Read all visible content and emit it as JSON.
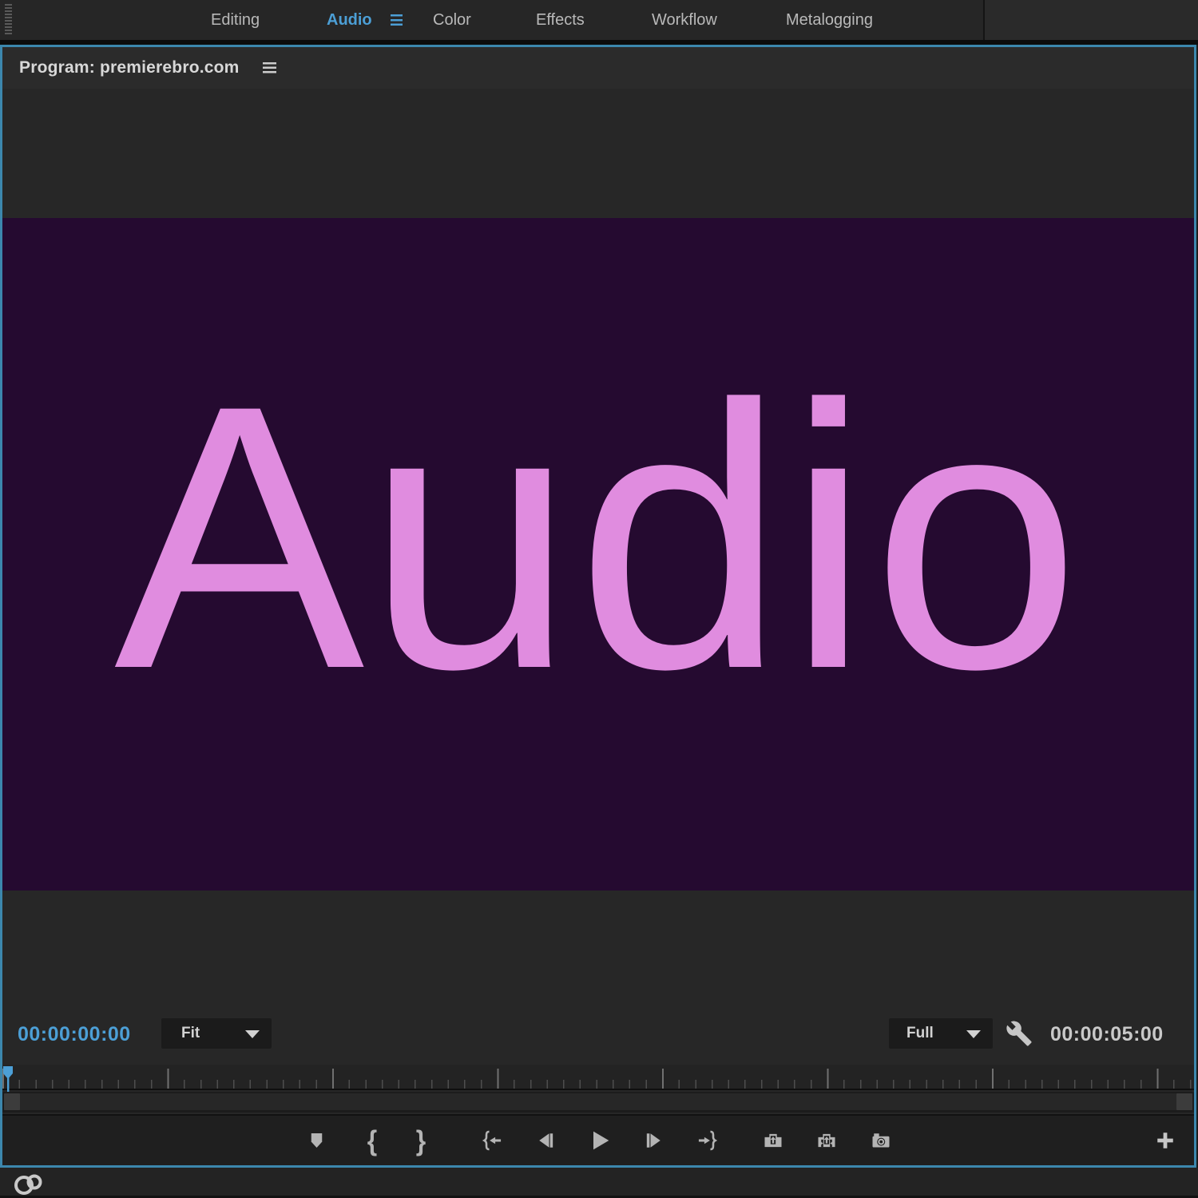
{
  "workspace_tabs": {
    "items": [
      {
        "label": "Editing"
      },
      {
        "label": "Audio"
      },
      {
        "label": "Color"
      },
      {
        "label": "Effects"
      },
      {
        "label": "Workflow"
      },
      {
        "label": "Metalogging"
      }
    ],
    "active_tab": "Audio"
  },
  "program_panel": {
    "title": "Program: premierebro.com",
    "viewer_text": "Audio",
    "current_timecode": "00:00:00:00",
    "zoom_select_value": "Fit",
    "resolution_select_value": "Full",
    "duration_timecode": "00:00:05:00"
  },
  "transport": {
    "mark_in_glyph": "{",
    "mark_out_glyph": "}",
    "buttons": [
      {
        "icon": "add-marker-icon"
      },
      {
        "icon": "mark-in-icon"
      },
      {
        "icon": "mark-out-icon"
      },
      {
        "icon": "go-to-in-icon"
      },
      {
        "icon": "step-back-icon"
      },
      {
        "icon": "play-icon"
      },
      {
        "icon": "step-forward-icon"
      },
      {
        "icon": "go-to-out-icon"
      },
      {
        "icon": "lift-icon"
      },
      {
        "icon": "extract-icon"
      },
      {
        "icon": "export-frame-icon"
      },
      {
        "icon": "button-editor-plus-icon"
      }
    ]
  },
  "colors": {
    "accent_blue": "#4C9FD6",
    "panel_focus_border": "#3C87AD",
    "viewer_background": "#250A30",
    "viewer_text": "#E08CDF",
    "icon_gray": "#B4B4B4"
  }
}
